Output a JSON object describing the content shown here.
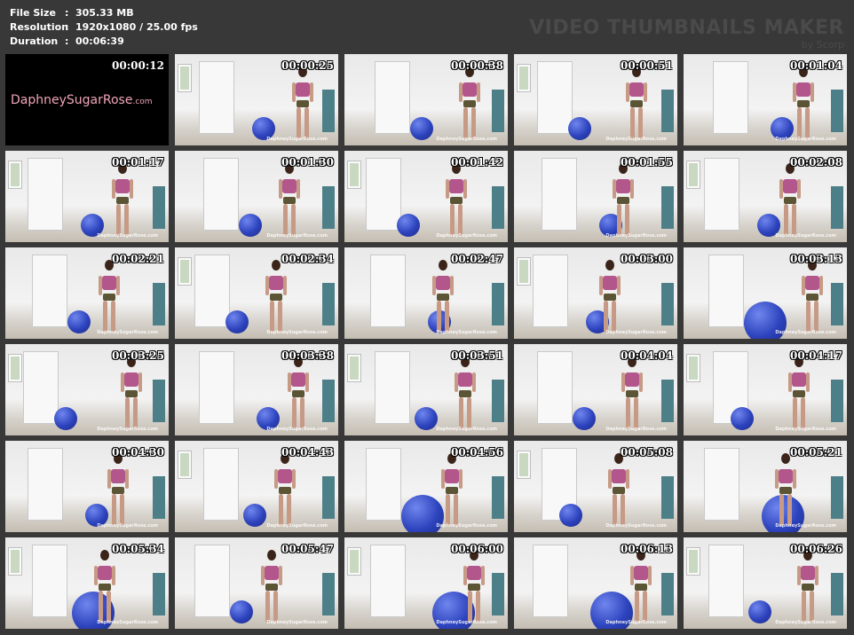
{
  "file_info": {
    "rows": [
      {
        "label": "File Size",
        "value": "305.33 MB"
      },
      {
        "label": "Resolution",
        "value": "1920x1080 / 25.00 fps"
      },
      {
        "label": "Duration",
        "value": "00:06:39"
      }
    ],
    "separator": ":"
  },
  "brand": {
    "title": "VIDEO THUMBNAILS MAKER",
    "by": "by Scorp"
  },
  "logo": {
    "text": "DaphneySugarRose",
    "suffix": ".com"
  },
  "watermark": "DaphneySugarRose.com",
  "thumbnails": [
    {
      "time": "00:00:12"
    },
    {
      "time": "00:00:25"
    },
    {
      "time": "00:00:38"
    },
    {
      "time": "00:00:51"
    },
    {
      "time": "00:01:04"
    },
    {
      "time": "00:01:17"
    },
    {
      "time": "00:01:30"
    },
    {
      "time": "00:01:42"
    },
    {
      "time": "00:01:55"
    },
    {
      "time": "00:02:08"
    },
    {
      "time": "00:02:21"
    },
    {
      "time": "00:02:34"
    },
    {
      "time": "00:02:47"
    },
    {
      "time": "00:03:00"
    },
    {
      "time": "00:03:13"
    },
    {
      "time": "00:03:25"
    },
    {
      "time": "00:03:38"
    },
    {
      "time": "00:03:51"
    },
    {
      "time": "00:04:04"
    },
    {
      "time": "00:04:17"
    },
    {
      "time": "00:04:30"
    },
    {
      "time": "00:04:43"
    },
    {
      "time": "00:04:56"
    },
    {
      "time": "00:05:08"
    },
    {
      "time": "00:05:21"
    },
    {
      "time": "00:05:34"
    },
    {
      "time": "00:05:47"
    },
    {
      "time": "00:06:00"
    },
    {
      "time": "00:06:13"
    },
    {
      "time": "00:06:26"
    }
  ],
  "colors": {
    "background": "#383838",
    "logo_pink": "#f0a5b8",
    "ball_blue": "#2d43bd"
  }
}
